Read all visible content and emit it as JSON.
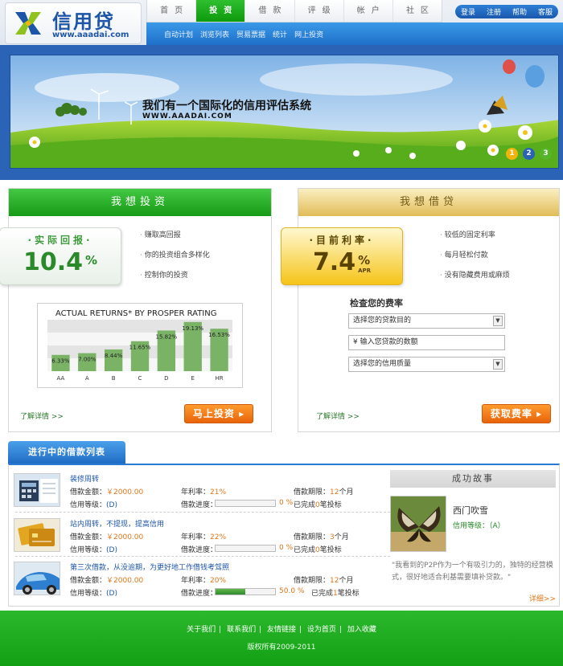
{
  "logo": {
    "title": "信用贷",
    "url": "www.aaadai.com"
  },
  "nav": {
    "items": [
      "首页",
      "投资",
      "借款",
      "评级",
      "帐户",
      "社区"
    ],
    "active": 1
  },
  "subnav": {
    "items": [
      "自动计划",
      "浏览列表",
      "贸易票据",
      "统计",
      "网上投资"
    ]
  },
  "toplinks": [
    "登录",
    "注册",
    "帮助",
    "客服"
  ],
  "banner": {
    "slogan": "我们有一个国际化的信用评估系统",
    "url": "WWW.AAADAI.COM",
    "dots": [
      "1",
      "2",
      "3"
    ]
  },
  "invest": {
    "heading": "我想投资",
    "tag_label": "·实际回报·",
    "tag_value": "10.4",
    "tag_unit": "%",
    "bullets": [
      "赚取高回报",
      "你的投资组合多样化",
      "控制你的投资"
    ],
    "more": "了解详情 >>",
    "button": "马上投资 ▸"
  },
  "chart_data": {
    "type": "bar",
    "title": "ACTUAL RETURNS* BY PROSPER RATING",
    "categories": [
      "AA",
      "A",
      "B",
      "C",
      "D",
      "E",
      "HR"
    ],
    "values": [
      6.33,
      7.0,
      8.44,
      11.65,
      15.82,
      19.13,
      16.53
    ],
    "value_labels": [
      "6.33%",
      "7.00%",
      "8.44%",
      "11.65%",
      "15.82%",
      "19.13%",
      "16.53%"
    ],
    "ylim": [
      0,
      20
    ],
    "grid": true,
    "bar_color": "#7ab366"
  },
  "borrow": {
    "heading": "我想借贷",
    "tag_label": "·目前利率·",
    "tag_value": "7.4",
    "tag_unit": "%",
    "tag_apr": "APR",
    "bullets": [
      "较低的固定利率",
      "每月轻松付款",
      "没有隐藏费用或麻烦"
    ],
    "rate_title": "检查您的费率",
    "select_purpose": "选择您的贷款目的",
    "amount_placeholder": "¥ 输入您贷款的数额",
    "select_credit": "选择您的信用质量",
    "more": "了解详情 >>",
    "button": "获取费率 ▸"
  },
  "loans": {
    "tab": "进行中的借款列表",
    "labels": {
      "amount": "借款金额：",
      "rate": "年利率：",
      "term": "借款期限：",
      "level": "信用等级：",
      "progress": "借款进度："
    },
    "items": [
      {
        "title": "装修周转",
        "amount": "￥2000.00",
        "rate": "21%",
        "term": "12",
        "term_unit": "个月",
        "level": "(D)",
        "progress": 0,
        "progress_text": "0 %",
        "done_pre": "已完成",
        "done_count": "0",
        "done_post": "笔投标"
      },
      {
        "title": "站内周转，不提现，提高信用",
        "amount": "￥2000.00",
        "rate": "22%",
        "term": "3",
        "term_unit": "个月",
        "level": "(D)",
        "progress": 0,
        "progress_text": "0 %",
        "done_pre": "已完成",
        "done_count": "0",
        "done_post": "笔投标"
      },
      {
        "title": "第三次借款，从没逾期，为更好地工作借钱考驾照",
        "amount": "￥2000.00",
        "rate": "20%",
        "term": "12",
        "term_unit": "个月",
        "level": "(D)",
        "progress": 50,
        "progress_text": "50.0 %",
        "done_pre": "已完成",
        "done_count": "1",
        "done_post": "笔投标"
      }
    ]
  },
  "story": {
    "heading": "成功故事",
    "name": "西门吹雪",
    "level": "信用等级：（A）",
    "quote": "\"我看到的P2P作为一个有吸引力的，独特的经营模式，很好地适合利基需要填补贷款。\"",
    "more": "详细>>"
  },
  "footer": {
    "links": [
      "关于我们",
      "联系我们",
      "友情链接",
      "设为首页",
      "加入收藏"
    ],
    "copyright": "版权所有2009-2011"
  }
}
